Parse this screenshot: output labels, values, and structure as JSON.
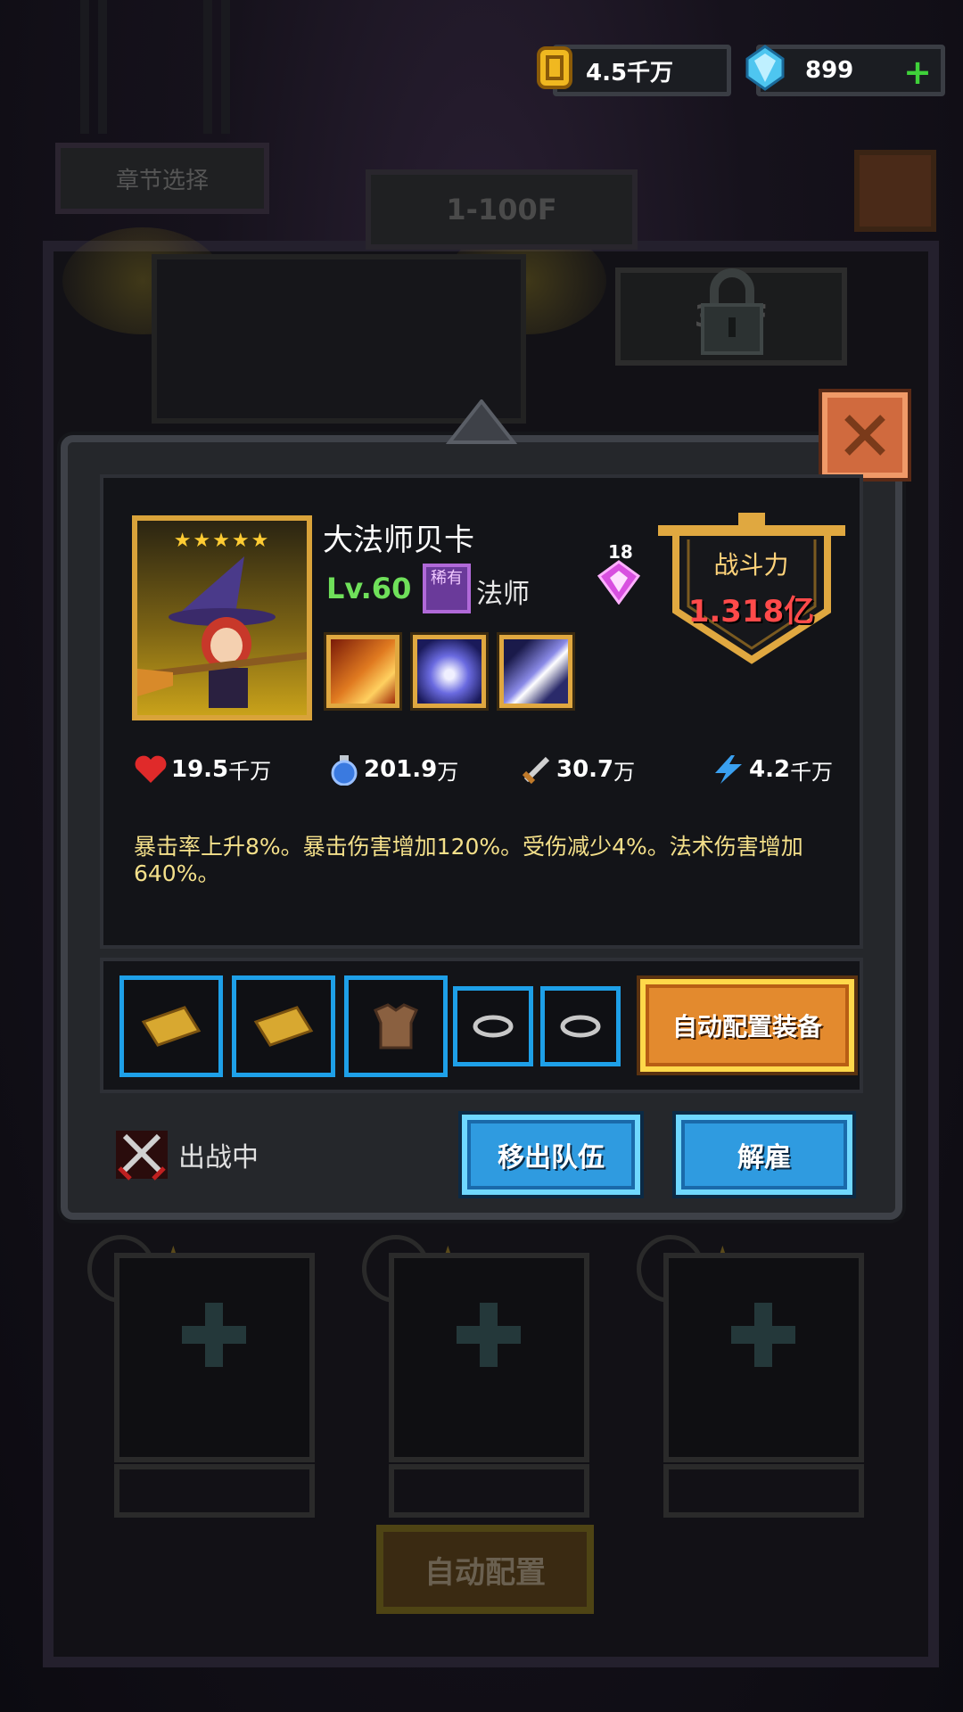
{
  "currency": {
    "coins": "4.5千万",
    "gems": "899"
  },
  "background": {
    "chapter_button": "章节选择",
    "floor_tab": "1-100F",
    "floor_tab_locked": "3 0F",
    "auto_config_button": "自动配置"
  },
  "hero": {
    "name": "大法师贝卡",
    "stars": "★★★★★",
    "level": "Lv.60",
    "rarity": "稀有",
    "class": "法师",
    "awaken_count": "18",
    "power_label": "战斗力",
    "power_value": "1.318亿"
  },
  "stats": {
    "hp": {
      "value": "19.5",
      "unit": "千万"
    },
    "mp": {
      "value": "201.9",
      "unit": "万"
    },
    "attack": {
      "value": "30.7",
      "unit": "万"
    },
    "speed": {
      "value": "4.2",
      "unit": "千万"
    }
  },
  "description": "暴击率上升8%。暴击伤害增加120%。受伤减少4%。法术伤害增加640%。",
  "equipment": {
    "auto_equip_button": "自动配置装备"
  },
  "actions": {
    "status": "出战中",
    "remove_button": "移出队伍",
    "dismiss_button": "解雇"
  },
  "colors": {
    "accent_gold": "#e0a840",
    "accent_blue": "#1ea0e8",
    "power_red": "#ff4a4a",
    "level_green": "#6fe05a"
  }
}
